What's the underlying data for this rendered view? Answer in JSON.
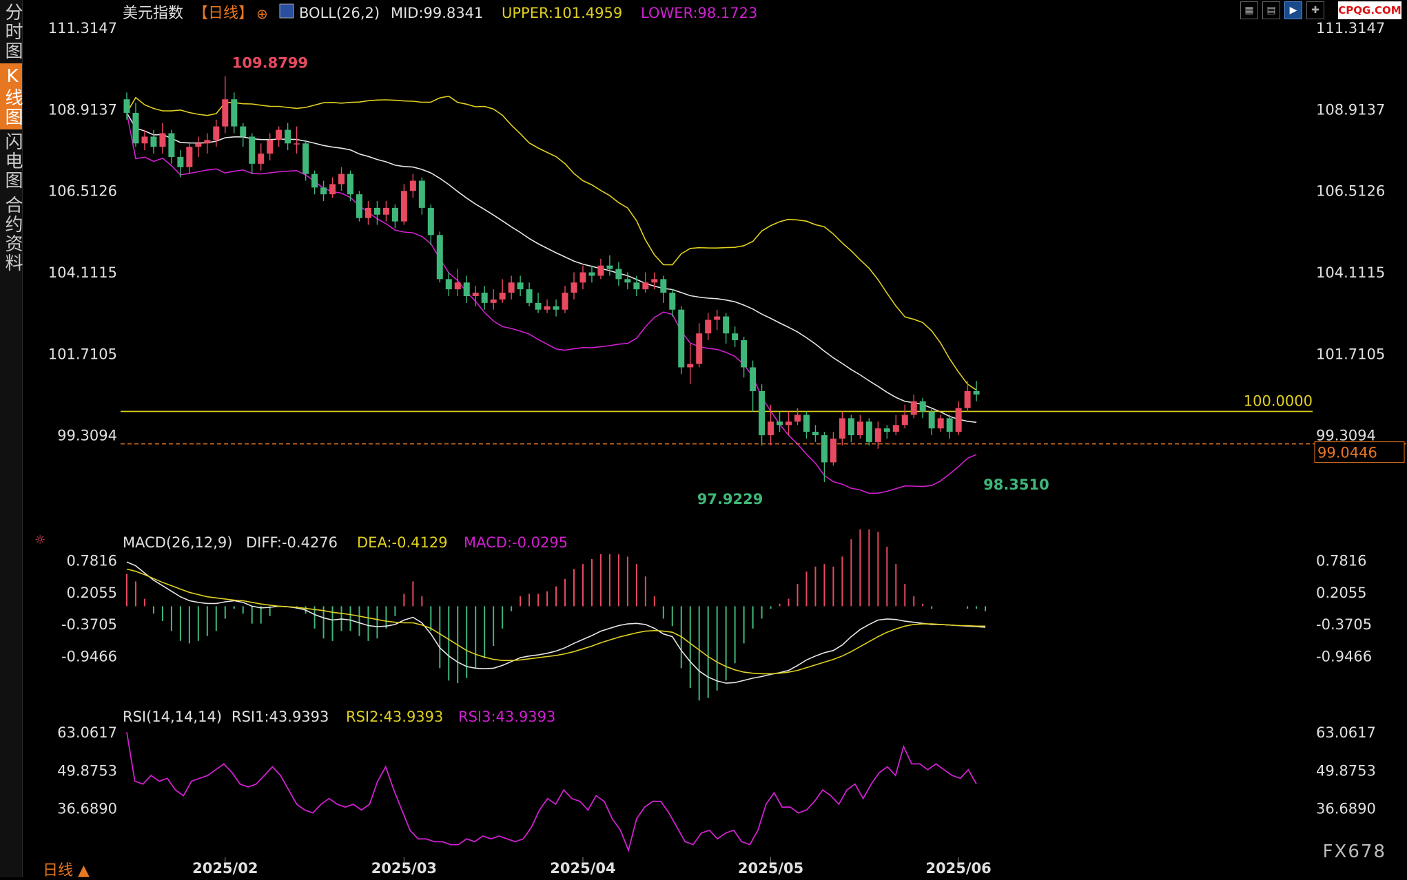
{
  "sidebar": {
    "tabs": [
      {
        "label": "分时图",
        "active": false
      },
      {
        "label": "K线图",
        "active": true
      },
      {
        "label": "闪电图",
        "active": false
      },
      {
        "label": "合约资料",
        "active": false
      }
    ]
  },
  "toolbar": {
    "icons": [
      "grid-icon",
      "layout-icon",
      "play-chart-icon",
      "cross-chart-icon"
    ]
  },
  "logo": "CPQG.COM",
  "period_label": "日线 ▲",
  "watermark": "FX678",
  "colors": {
    "up": "#e84a5f",
    "down": "#3fb77a",
    "mid": "#e6e6e6",
    "upper": "#e0d020",
    "lower": "#d020d0",
    "accent": "#e87722"
  },
  "chart_data": [
    {
      "type": "candlestick",
      "title": "美元指数",
      "period": "【日线】",
      "indicator": {
        "name": "BOLL(26,2)",
        "mid": "MID:99.8341",
        "upper": "UPPER:101.4959",
        "lower": "LOWER:98.1723"
      },
      "y_ticks": [
        "111.3147",
        "108.9137",
        "106.5126",
        "104.1115",
        "101.7105",
        "99.3094"
      ],
      "y_tick_values": [
        111.3147,
        108.9137,
        106.5126,
        104.1115,
        101.7105,
        99.3094
      ],
      "ylim": [
        96.5,
        111.3147
      ],
      "x_ticks": [
        "2025/02",
        "2025/03",
        "2025/04",
        "2025/05",
        "2025/06"
      ],
      "x_tick_index": [
        11,
        31,
        51,
        72,
        93
      ],
      "reference_line": {
        "value": 100.0,
        "label": "100.0000"
      },
      "current_price": {
        "value": 99.0446,
        "label": "99.0446"
      },
      "annotations": [
        {
          "label": "109.8799",
          "value": 109.8799,
          "index": 11
        },
        {
          "label": "97.9229",
          "value": 97.9229,
          "index": 63
        },
        {
          "label": "98.3510",
          "value": 98.351,
          "index": 95
        }
      ],
      "candles": [
        [
          109.2,
          108.8,
          109.4,
          108.6
        ],
        [
          108.8,
          107.9,
          109.1,
          107.8
        ],
        [
          107.9,
          108.1,
          108.3,
          107.7
        ],
        [
          108.1,
          107.8,
          108.3,
          107.6
        ],
        [
          107.8,
          108.2,
          108.5,
          107.6
        ],
        [
          108.2,
          107.5,
          108.3,
          107.3
        ],
        [
          107.5,
          107.2,
          107.7,
          106.9
        ],
        [
          107.2,
          107.8,
          107.9,
          107.0
        ],
        [
          107.8,
          107.9,
          108.1,
          107.5
        ],
        [
          107.9,
          108.0,
          108.2,
          107.6
        ],
        [
          108.0,
          108.4,
          108.6,
          107.8
        ],
        [
          108.4,
          109.2,
          109.88,
          108.2
        ],
        [
          109.2,
          108.4,
          109.4,
          108.2
        ],
        [
          108.4,
          108.1,
          108.5,
          107.8
        ],
        [
          108.1,
          107.3,
          108.2,
          107.0
        ],
        [
          107.3,
          107.6,
          107.9,
          107.1
        ],
        [
          107.6,
          108.0,
          108.2,
          107.4
        ],
        [
          108.0,
          108.3,
          108.4,
          107.8
        ],
        [
          108.3,
          107.9,
          108.5,
          107.7
        ],
        [
          107.9,
          107.9,
          108.4,
          107.6
        ],
        [
          107.9,
          107.0,
          108.0,
          106.8
        ],
        [
          107.0,
          106.6,
          107.1,
          106.4
        ],
        [
          106.6,
          106.4,
          106.8,
          106.2
        ],
        [
          106.4,
          106.7,
          106.9,
          106.3
        ],
        [
          106.7,
          107.0,
          107.2,
          106.5
        ],
        [
          107.0,
          106.4,
          107.1,
          106.2
        ],
        [
          106.4,
          105.7,
          106.5,
          105.6
        ],
        [
          105.7,
          106.0,
          106.2,
          105.5
        ],
        [
          106.0,
          105.8,
          106.2,
          105.5
        ],
        [
          105.8,
          106.0,
          106.2,
          105.6
        ],
        [
          106.0,
          105.6,
          106.1,
          105.4
        ],
        [
          105.6,
          106.5,
          106.7,
          105.5
        ],
        [
          106.5,
          106.8,
          107.0,
          106.3
        ],
        [
          106.8,
          106.0,
          106.9,
          105.8
        ],
        [
          106.0,
          105.2,
          106.1,
          104.9
        ],
        [
          105.2,
          103.9,
          105.3,
          103.8
        ],
        [
          103.9,
          103.6,
          104.1,
          103.4
        ],
        [
          103.6,
          103.8,
          104.2,
          103.4
        ],
        [
          103.8,
          103.4,
          104.0,
          103.2
        ],
        [
          103.4,
          103.5,
          103.7,
          103.1
        ],
        [
          103.5,
          103.2,
          103.7,
          103.0
        ],
        [
          103.2,
          103.3,
          103.6,
          103.0
        ],
        [
          103.3,
          103.5,
          103.9,
          103.2
        ],
        [
          103.5,
          103.8,
          104.0,
          103.3
        ],
        [
          103.8,
          103.6,
          104.0,
          103.4
        ],
        [
          103.6,
          103.2,
          103.8,
          103.1
        ],
        [
          103.2,
          103.0,
          103.5,
          102.9
        ],
        [
          103.0,
          103.1,
          103.3,
          102.9
        ],
        [
          103.1,
          103.0,
          103.3,
          102.8
        ],
        [
          103.0,
          103.5,
          103.7,
          102.9
        ],
        [
          103.5,
          103.8,
          104.1,
          103.3
        ],
        [
          103.8,
          104.1,
          104.3,
          103.6
        ],
        [
          104.1,
          104.0,
          104.3,
          103.8
        ],
        [
          104.0,
          104.3,
          104.5,
          103.9
        ],
        [
          104.3,
          104.2,
          104.6,
          104.0
        ],
        [
          104.2,
          103.9,
          104.4,
          103.7
        ],
        [
          103.9,
          103.8,
          104.1,
          103.6
        ],
        [
          103.8,
          103.6,
          104.0,
          103.4
        ],
        [
          103.6,
          103.8,
          104.1,
          103.5
        ],
        [
          103.8,
          103.9,
          104.1,
          103.6
        ],
        [
          103.9,
          103.5,
          104.0,
          103.2
        ],
        [
          103.5,
          103.0,
          103.6,
          102.8
        ],
        [
          103.0,
          101.3,
          103.1,
          101.1
        ],
        [
          101.3,
          101.4,
          102.0,
          100.8
        ],
        [
          101.4,
          102.3,
          102.6,
          101.3
        ],
        [
          102.3,
          102.7,
          102.9,
          102.1
        ],
        [
          102.7,
          102.8,
          103.0,
          102.4
        ],
        [
          102.8,
          102.3,
          102.9,
          102.0
        ],
        [
          102.3,
          102.1,
          102.5,
          101.9
        ],
        [
          102.1,
          101.3,
          102.2,
          101.0
        ],
        [
          101.3,
          100.6,
          101.5,
          100.0
        ],
        [
          100.6,
          99.3,
          100.8,
          99.0
        ],
        [
          99.3,
          99.7,
          100.2,
          99.0
        ],
        [
          99.7,
          99.6,
          100.0,
          99.4
        ],
        [
          99.6,
          99.7,
          100.0,
          99.3
        ],
        [
          99.7,
          99.9,
          100.1,
          99.6
        ],
        [
          99.9,
          99.4,
          100.0,
          99.2
        ],
        [
          99.4,
          99.3,
          99.6,
          99.1
        ],
        [
          99.3,
          98.5,
          99.4,
          97.92
        ],
        [
          98.5,
          99.2,
          99.4,
          98.4
        ],
        [
          99.2,
          99.8,
          100.0,
          99.0
        ],
        [
          99.8,
          99.3,
          99.9,
          99.1
        ],
        [
          99.3,
          99.7,
          99.9,
          99.2
        ],
        [
          99.7,
          99.1,
          99.8,
          99.0
        ],
        [
          99.1,
          99.5,
          99.7,
          98.9
        ],
        [
          99.5,
          99.4,
          99.6,
          99.2
        ],
        [
          99.4,
          99.6,
          99.9,
          99.3
        ],
        [
          99.6,
          99.9,
          100.2,
          99.5
        ],
        [
          99.9,
          100.3,
          100.5,
          99.8
        ],
        [
          100.3,
          100.0,
          100.4,
          99.8
        ],
        [
          100.0,
          99.5,
          100.1,
          99.3
        ],
        [
          99.5,
          99.8,
          99.9,
          99.4
        ],
        [
          99.8,
          99.4,
          99.9,
          99.2
        ],
        [
          99.4,
          100.1,
          100.3,
          99.3
        ],
        [
          100.1,
          100.6,
          100.9,
          100.0
        ],
        [
          100.6,
          100.5,
          100.9,
          100.3
        ]
      ]
    },
    {
      "type": "line",
      "title": "MACD(26,12,9)",
      "series_labels": [
        {
          "name": "DIFF",
          "label": "DIFF:-0.4276"
        },
        {
          "name": "DEA",
          "label": "DEA:-0.4129"
        },
        {
          "name": "MACD",
          "label": "MACD:-0.0295"
        }
      ],
      "y_ticks": [
        "0.7816",
        "0.2055",
        "-0.3705",
        "-0.9466"
      ],
      "y_tick_values": [
        0.7816,
        0.2055,
        -0.3705,
        -0.9466
      ],
      "ylim": [
        -1.6,
        0.95
      ],
      "diff": [
        0.75,
        0.68,
        0.55,
        0.42,
        0.32,
        0.22,
        0.12,
        0.05,
        0.02,
        0.0,
        0.0,
        0.03,
        0.05,
        0.02,
        -0.05,
        -0.08,
        -0.07,
        -0.05,
        -0.06,
        -0.08,
        -0.12,
        -0.2,
        -0.26,
        -0.3,
        -0.28,
        -0.3,
        -0.35,
        -0.4,
        -0.42,
        -0.41,
        -0.38,
        -0.3,
        -0.25,
        -0.35,
        -0.55,
        -0.8,
        -0.95,
        -1.06,
        -1.14,
        -1.17,
        -1.18,
        -1.17,
        -1.12,
        -1.05,
        -0.98,
        -0.95,
        -0.93,
        -0.9,
        -0.86,
        -0.8,
        -0.72,
        -0.65,
        -0.58,
        -0.5,
        -0.45,
        -0.4,
        -0.37,
        -0.36,
        -0.38,
        -0.45,
        -0.55,
        -0.6,
        -0.85,
        -1.05,
        -1.22,
        -1.33,
        -1.4,
        -1.44,
        -1.43,
        -1.39,
        -1.35,
        -1.32,
        -1.28,
        -1.25,
        -1.21,
        -1.12,
        -1.02,
        -0.95,
        -0.89,
        -0.85,
        -0.75,
        -0.6,
        -0.47,
        -0.38,
        -0.3,
        -0.28,
        -0.29,
        -0.32,
        -0.34,
        -0.36,
        -0.38,
        -0.38,
        -0.39,
        -0.4,
        -0.41,
        -0.42,
        -0.43
      ],
      "dea": [
        0.62,
        0.58,
        0.52,
        0.45,
        0.38,
        0.32,
        0.26,
        0.2,
        0.16,
        0.12,
        0.1,
        0.08,
        0.06,
        0.05,
        0.02,
        -0.01,
        -0.03,
        -0.05,
        -0.06,
        -0.07,
        -0.09,
        -0.11,
        -0.13,
        -0.16,
        -0.18,
        -0.2,
        -0.23,
        -0.26,
        -0.29,
        -0.32,
        -0.34,
        -0.35,
        -0.35,
        -0.39,
        -0.45,
        -0.55,
        -0.65,
        -0.75,
        -0.85,
        -0.92,
        -0.97,
        -1.01,
        -1.03,
        -1.03,
        -1.02,
        -1.0,
        -0.98,
        -0.96,
        -0.94,
        -0.91,
        -0.87,
        -0.82,
        -0.77,
        -0.71,
        -0.66,
        -0.61,
        -0.57,
        -0.53,
        -0.5,
        -0.49,
        -0.5,
        -0.52,
        -0.6,
        -0.72,
        -0.84,
        -0.96,
        -1.06,
        -1.14,
        -1.2,
        -1.24,
        -1.26,
        -1.27,
        -1.27,
        -1.26,
        -1.24,
        -1.21,
        -1.16,
        -1.11,
        -1.06,
        -1.01,
        -0.95,
        -0.87,
        -0.78,
        -0.69,
        -0.6,
        -0.52,
        -0.46,
        -0.41,
        -0.38,
        -0.37,
        -0.37,
        -0.38,
        -0.39,
        -0.4,
        -0.4,
        -0.41,
        -0.41
      ]
    },
    {
      "type": "line",
      "title": "RSI(14,14,14)",
      "series_labels": [
        {
          "name": "RSI1",
          "label": "RSI1:43.9393"
        },
        {
          "name": "RSI2",
          "label": "RSI2:43.9393"
        },
        {
          "name": "RSI3",
          "label": "RSI3:43.9393"
        }
      ],
      "y_ticks": [
        "63.0617",
        "49.8753",
        "36.6890"
      ],
      "y_tick_values": [
        63.0617,
        49.8753,
        36.689
      ],
      "ylim": [
        22,
        65
      ],
      "rsi": [
        63,
        46,
        45,
        48,
        46,
        47,
        43,
        41,
        46,
        47,
        48,
        50,
        52,
        49,
        45,
        44,
        45,
        48,
        51,
        48,
        43,
        38,
        36,
        35,
        38,
        40,
        38,
        37,
        38,
        36,
        38,
        46,
        51,
        43,
        36,
        29,
        26,
        26,
        25,
        25,
        24,
        24,
        26,
        25,
        27,
        26,
        27,
        26,
        25,
        26,
        30,
        36,
        40,
        38,
        43,
        40,
        39,
        36,
        41,
        39,
        33,
        29,
        22,
        33,
        37,
        39,
        39,
        35,
        30,
        25,
        24,
        28,
        29,
        26,
        28,
        29,
        25,
        24,
        29,
        38,
        42,
        37,
        37,
        35,
        36,
        39,
        43,
        41,
        38,
        43,
        45,
        40,
        45,
        49,
        51,
        48,
        58,
        52,
        52,
        50,
        52,
        50,
        48,
        47,
        50,
        45
      ]
    }
  ]
}
